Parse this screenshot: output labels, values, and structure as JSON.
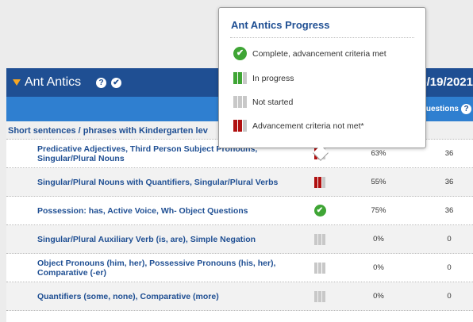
{
  "header": {
    "title": "Ant Antics",
    "help_glyph": "?",
    "check_glyph": "✔",
    "date": "5/19/2021"
  },
  "subheader": {
    "questions_label": "uestions",
    "help_glyph": "?"
  },
  "section": {
    "label": "Short sentences / phrases with Kindergarten lev"
  },
  "rows": [
    {
      "lesson": "Predicative Adjectives, Third Person Subject Pronouns, Singular/Plural Nouns",
      "status": "not_met",
      "percent": "63%",
      "questions": "36"
    },
    {
      "lesson": "Singular/Plural Nouns with Quantifiers, Singular/Plural Verbs",
      "status": "not_met",
      "percent": "55%",
      "questions": "36"
    },
    {
      "lesson": "Possession: has, Active Voice, Wh- Object Questions",
      "status": "complete",
      "percent": "75%",
      "questions": "36"
    },
    {
      "lesson": "Singular/Plural Auxiliary Verb (is, are), Simple Negation",
      "status": "not_started",
      "percent": "0%",
      "questions": "0"
    },
    {
      "lesson": "Object Pronouns (him, her), Possessive Pronouns (his, her), Comparative (-er)",
      "status": "not_started",
      "percent": "0%",
      "questions": "0"
    },
    {
      "lesson": "Quantifiers (some, none), Comparative (more)",
      "status": "not_started",
      "percent": "0%",
      "questions": "0"
    }
  ],
  "tooltip": {
    "title": "Ant Antics Progress",
    "legend": [
      {
        "icon": "check-circle-icon",
        "label": "Complete, advancement criteria met"
      },
      {
        "icon": "in-progress-bars-icon",
        "label": "In progress"
      },
      {
        "icon": "not-started-bars-icon",
        "label": "Not started"
      },
      {
        "icon": "not-met-bars-icon",
        "label": "Advancement criteria not met*"
      }
    ]
  },
  "colors": {
    "header_dark": "#1f4f93",
    "header_light": "#2f7fd0",
    "green": "#3fa535",
    "red": "#b01010",
    "gray": "#c8c8c8"
  }
}
